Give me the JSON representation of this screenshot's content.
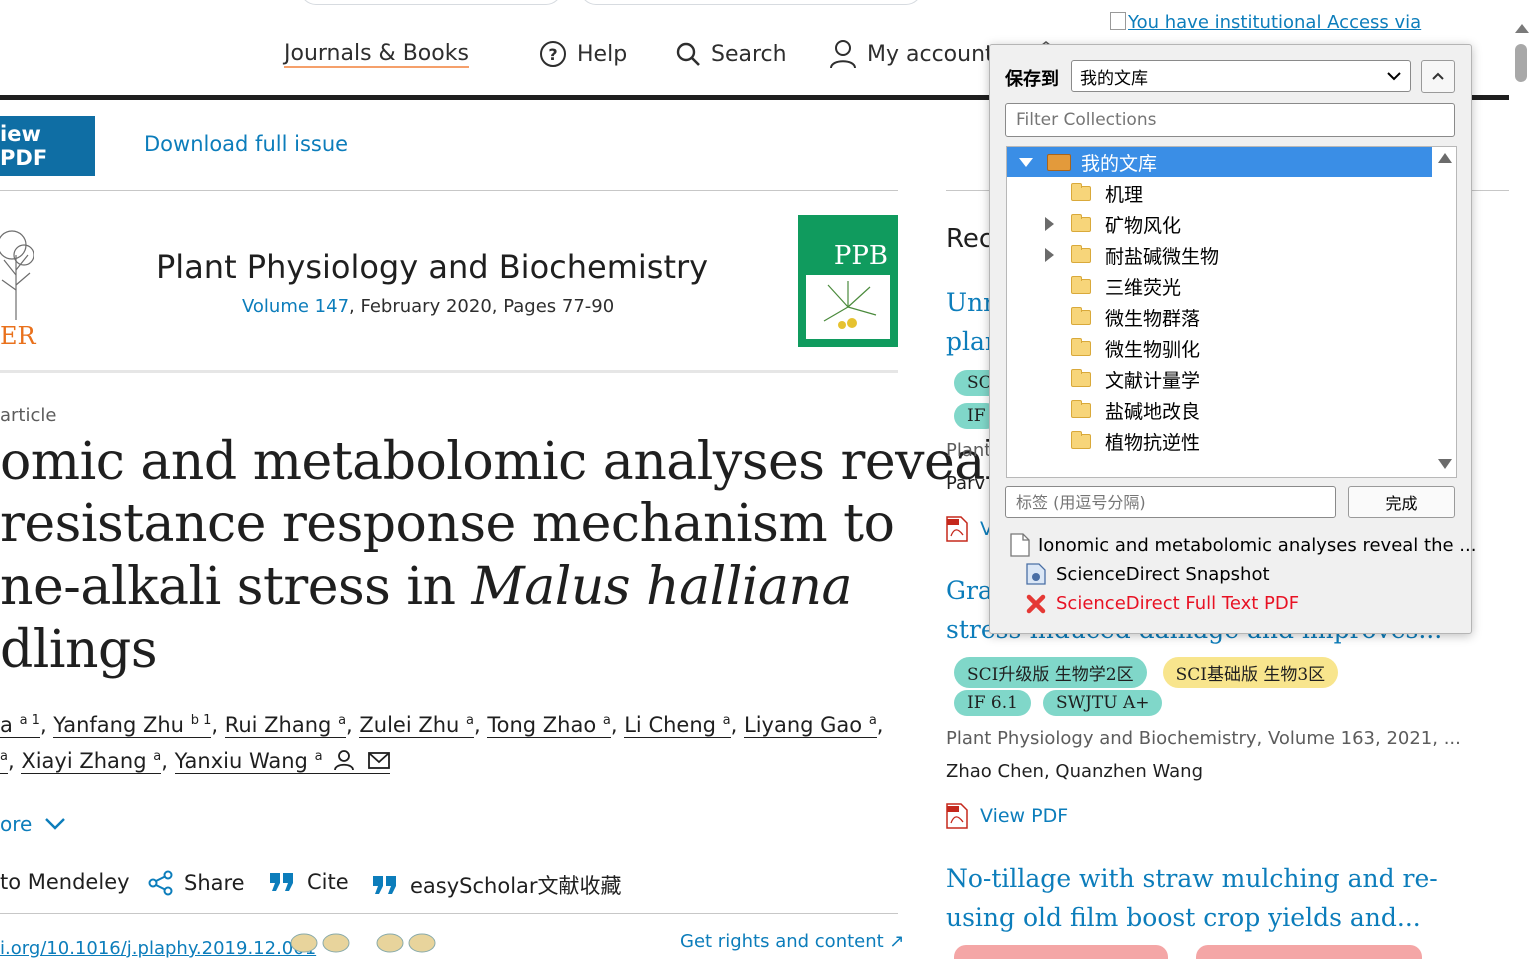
{
  "nav": {
    "journals_books": "Journals & Books",
    "help": "Help",
    "search": "Search",
    "my_account": "My account",
    "institutional_access": "You have institutional Access via"
  },
  "toolbar": {
    "view_pdf": "iew PDF",
    "download_issue": "Download full issue"
  },
  "journal": {
    "publisher_fragment": "ER",
    "name": "Plant Physiology and Biochemistry",
    "volume_link": "Volume 147",
    "details": ", February 2020, Pages 77-90",
    "cover_title": "PPB"
  },
  "article": {
    "type_label": "article",
    "title_lines": [
      "omic and metabolomic analyses reveal",
      "resistance response mechanism to",
      "ne-alkali stress in ",
      "dlings"
    ],
    "title_italic": "Malus halliana",
    "authors_row1": [
      {
        "name": "a",
        "sup": "a 1"
      },
      {
        "name": "Yanfang Zhu",
        "sup": "b 1"
      },
      {
        "name": "Rui Zhang",
        "sup": "a"
      },
      {
        "name": "Zulei Zhu",
        "sup": "a"
      },
      {
        "name": "Tong Zhao",
        "sup": "a"
      },
      {
        "name": "Li Cheng",
        "sup": "a"
      },
      {
        "name": "Liyang Gao",
        "sup": "a"
      }
    ],
    "authors_row2": [
      {
        "name": "",
        "sup": "a"
      },
      {
        "name": "Xiayi Zhang",
        "sup": "a"
      },
      {
        "name": "Yanxiu Wang",
        "sup": "a"
      }
    ],
    "show_more": "ore",
    "actions": {
      "mendeley": "to Mendeley",
      "share": "Share",
      "cite": "Cite",
      "easyscholar": "easyScholar文献收藏"
    },
    "doi_fragment": "i.org/10.1016/j.plaphy.2019.12.001",
    "rights": "Get rights and content ↗"
  },
  "recommended": {
    "heading": "Rec",
    "item1": {
      "title_frag1": "Unra",
      "title_frag2": "plan",
      "tag1": "SC",
      "tag2": "IF",
      "journal_frag": "Plant",
      "authors_frag": "Parv",
      "pdf_frag": "V"
    },
    "item2": {
      "title_frag1": "Grap",
      "title_line2": "stress-induced damage and improves...",
      "tags": [
        "SCI升级版 生物学2区",
        "SCI基础版 生物3区",
        "IF 6.1",
        "SWJTU A+"
      ],
      "journal": "Plant Physiology and Biochemistry, Volume 163, 2021, ...",
      "authors": "Zhao Chen, Quanzhen Wang",
      "view_pdf": "View PDF"
    },
    "item3": {
      "title_line1": "No-tillage with straw mulching and re-",
      "title_line2": "using old film boost crop yields and..."
    }
  },
  "zotero": {
    "save_to_label": "保存到",
    "selected_collection": "我的文库",
    "filter_placeholder": "Filter Collections",
    "library": "我的文库",
    "collections": [
      {
        "name": "机理",
        "expandable": false
      },
      {
        "name": "矿物风化",
        "expandable": true
      },
      {
        "name": "耐盐碱微生物",
        "expandable": true
      },
      {
        "name": "三维荧光",
        "expandable": false
      },
      {
        "name": "微生物群落",
        "expandable": false
      },
      {
        "name": "微生物驯化",
        "expandable": false
      },
      {
        "name": "文献计量学",
        "expandable": false
      },
      {
        "name": "盐碱地改良",
        "expandable": false
      },
      {
        "name": "植物抗逆性",
        "expandable": false
      }
    ],
    "tags_placeholder": "标签 (用逗号分隔)",
    "done_button": "完成",
    "item_title": "Ionomic and metabolomic analyses reveal the ...",
    "attachment_snapshot": "ScienceDirect Snapshot",
    "attachment_pdf": "ScienceDirect Full Text PDF",
    "colors": {
      "selected": "#3a8ee6",
      "error_text": "#e81123"
    }
  }
}
